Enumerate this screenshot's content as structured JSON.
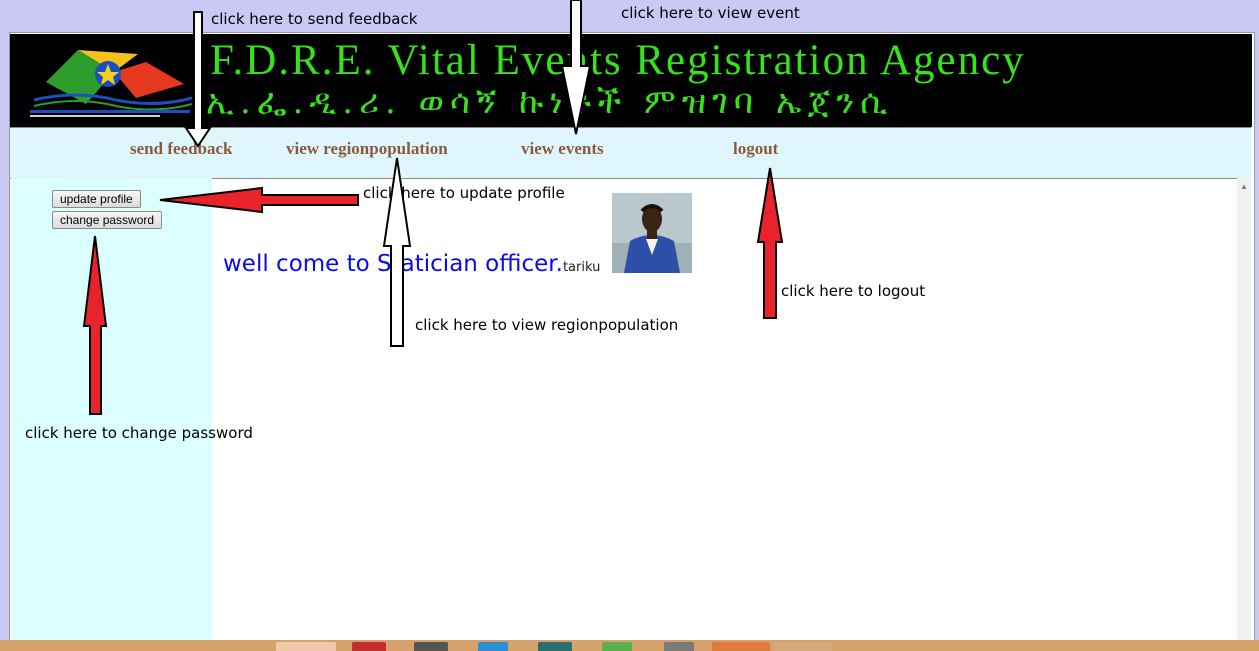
{
  "header": {
    "title_en": "F.D.R.E. Vital Events Registration Agency",
    "title_am": "ኢ.ፌ.ዲ.ሪ. ወሳኝ ኩነቶች ምዝገባ ኤጀንሲ"
  },
  "nav": {
    "send_feedback": "send feedback",
    "view_regionpopulation": "view regionpopulation",
    "view_events": "view events",
    "logout": "logout"
  },
  "sidebar": {
    "update_profile": "update profile",
    "change_password": "change password"
  },
  "welcome": {
    "text": "well come to Statician officer.",
    "username": "tariku"
  },
  "annotations": {
    "send_feedback": "click here to send feedback",
    "view_event": "click here to view event",
    "update_profile": "click here to update profile",
    "logout": "click here to logout",
    "view_regionpopulation": "click here to view regionpopulation",
    "change_password": "click here to change password"
  },
  "colors": {
    "banner_text": "#36e21a",
    "nav_link": "#8b5a3c",
    "welcome_text": "#0a0aee",
    "red_arrow": "#e8232a"
  }
}
